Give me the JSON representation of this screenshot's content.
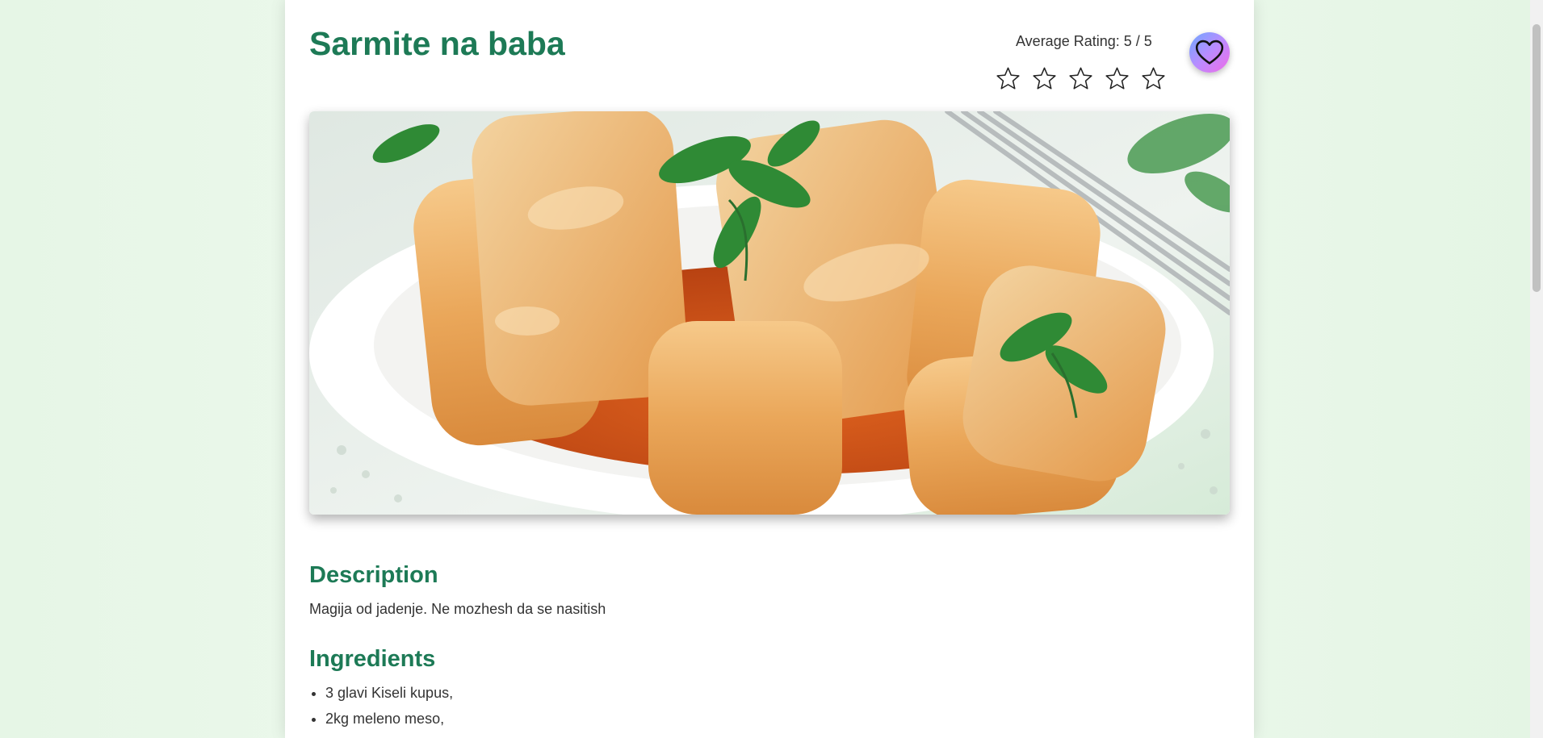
{
  "recipe": {
    "title": "Sarmite na baba",
    "rating_label": "Average Rating: 5 / 5",
    "rating_value": 5,
    "rating_max": 5,
    "favorite_icon": "heart-icon",
    "image_subject": "cabbage rolls",
    "description_heading": "Description",
    "description": "Magija od jadenje. Ne mozhesh da se nasitish",
    "ingredients_heading": "Ingredients",
    "ingredients": [
      "3 glavi Kiseli kupus,",
      "2kg meleno meso,"
    ]
  },
  "colors": {
    "accent": "#1d7a56",
    "background": "#e8f6e8"
  }
}
